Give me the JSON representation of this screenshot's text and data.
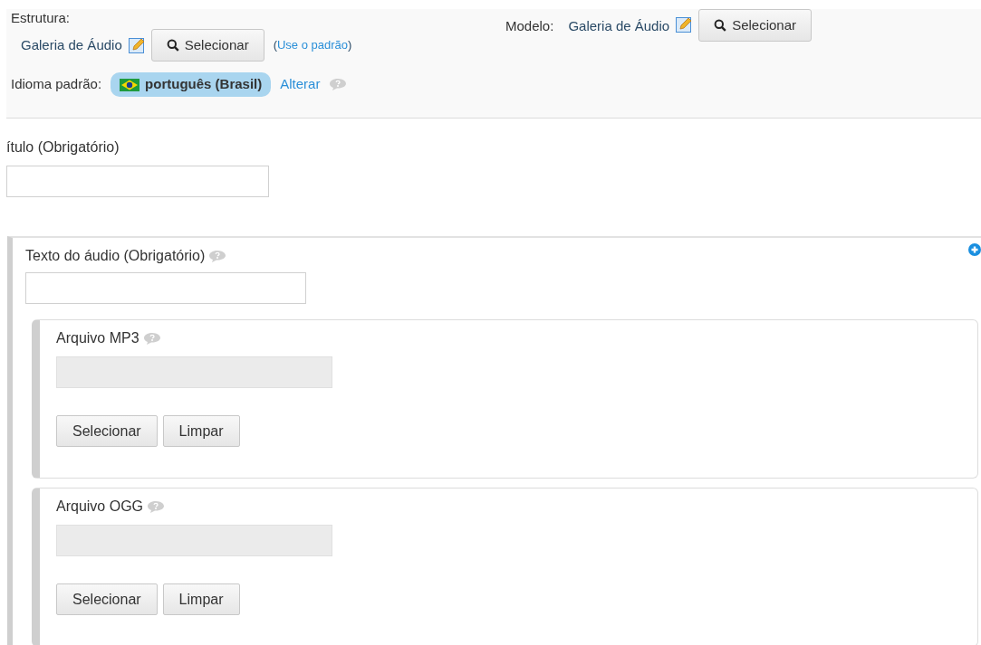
{
  "structure": {
    "label": "Estrutura:",
    "value": "Galeria de Áudio",
    "select_button": "Selecionar",
    "default_open": "(",
    "default_link": "Use o padrão",
    "default_close": ")"
  },
  "template": {
    "label": "Modelo:",
    "value": "Galeria de Áudio",
    "select_button": "Selecionar"
  },
  "language": {
    "label": "Idioma padrão:",
    "value": "português (Brasil)",
    "change_link": "Alterar"
  },
  "title_field": {
    "label": "ítulo (Obrigatório)"
  },
  "audio_group": {
    "label": "Texto do áudio (Obrigatório)",
    "files": [
      {
        "label": "Arquivo MP3",
        "disabled": true,
        "buttons": [
          "Selecionar",
          "Limpar"
        ]
      },
      {
        "label": "Arquivo OGG",
        "disabled": true,
        "buttons": [
          "Selecionar",
          "Limpar"
        ]
      }
    ]
  }
}
